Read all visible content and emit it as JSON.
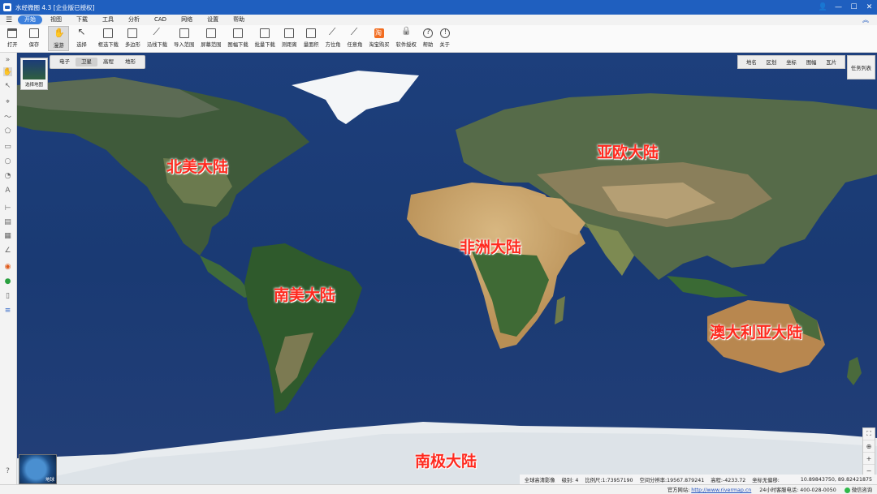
{
  "window": {
    "title": "水经微图 4.3 [企业版已授权]",
    "icons": [
      "minimize-icon",
      "maximize-icon",
      "close-icon"
    ]
  },
  "menu": {
    "items": [
      "开始",
      "视图",
      "下载",
      "工具",
      "分析",
      "CAD",
      "网络",
      "设置",
      "帮助"
    ]
  },
  "toolbar": {
    "items": [
      "打开",
      "保存",
      "漫游",
      "选择",
      "框选下载",
      "多边形",
      "沿线下载",
      "导入范围",
      "屏幕范围",
      "图幅下载",
      "批量下载",
      "测距离",
      "量面积",
      "方位角",
      "任意角",
      "淘宝购买",
      "软件授权",
      "帮助",
      "关于"
    ]
  },
  "map": {
    "mode_tabs": [
      "电子",
      "卫星",
      "高程",
      "地形"
    ],
    "layer_switch_label": "选择地图",
    "right_tabs": [
      "地名",
      "区划",
      "坐标",
      "图幅",
      "瓦片"
    ],
    "task_list": "任务列表",
    "globe_label": "地球",
    "continents": {
      "north_america": "北美大陆",
      "eurasia": "亚欧大陆",
      "africa": "非洲大陆",
      "south_america": "南美大陆",
      "australia": "澳大利亚大陆",
      "antarctica": "南极大陆"
    },
    "info": {
      "layer": "全球高清影像",
      "level_label": "级别:",
      "level": "4",
      "scale_label": "比例尺:",
      "scale": "1:73957190",
      "resolution_label": "空间分辨率:",
      "resolution": "19567.879241",
      "elevation_label": "高程:",
      "elevation": "-4233.72",
      "offset_label": "坐标无偏移:",
      "coords": "10.89843750, 89.82421875"
    }
  },
  "status": {
    "site_label": "官方网站:",
    "site_url": "http://www.rivermap.cn",
    "hotline": "24小时客服电话: 400-028-0050",
    "wechat": "微信咨询"
  }
}
